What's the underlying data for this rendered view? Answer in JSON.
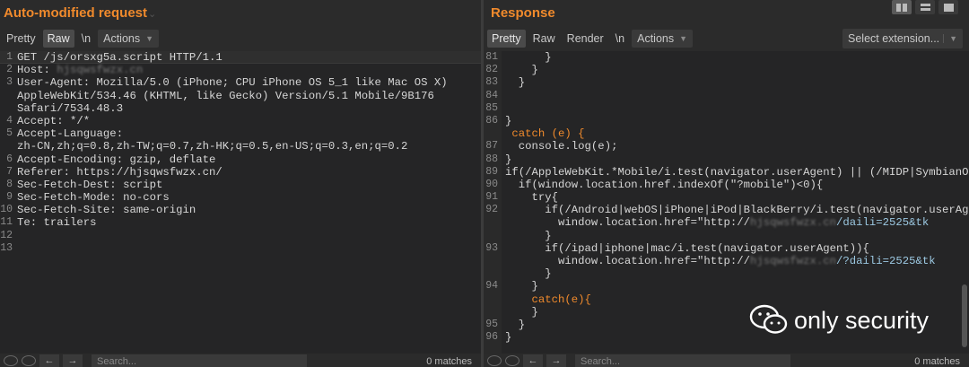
{
  "left": {
    "title": "Auto-modified request",
    "toolbar": {
      "pretty": "Pretty",
      "raw": "Raw",
      "newline": "\\n",
      "actions": "Actions"
    },
    "lines": [
      {
        "n": "1",
        "t": "GET /js/orsxg5a.script HTTP/1.1"
      },
      {
        "n": "2",
        "t": "Host: "
      },
      {
        "n": "3",
        "t": "User-Agent: Mozilla/5.0 (iPhone; CPU iPhone OS 5_1 like Mac OS X)"
      },
      {
        "n": "",
        "t": "AppleWebKit/534.46 (KHTML, like Gecko) Version/5.1 Mobile/9B176"
      },
      {
        "n": "",
        "t": "Safari/7534.48.3"
      },
      {
        "n": "4",
        "t": "Accept: */*"
      },
      {
        "n": "5",
        "t": "Accept-Language:"
      },
      {
        "n": "",
        "t": "zh-CN,zh;q=0.8,zh-TW;q=0.7,zh-HK;q=0.5,en-US;q=0.3,en;q=0.2"
      },
      {
        "n": "6",
        "t": "Accept-Encoding: gzip, deflate"
      },
      {
        "n": "7",
        "t": "Referer: https://hjsqwsfwzx.cn/"
      },
      {
        "n": "8",
        "t": "Sec-Fetch-Dest: script"
      },
      {
        "n": "9",
        "t": "Sec-Fetch-Mode: no-cors"
      },
      {
        "n": "10",
        "t": "Sec-Fetch-Site: same-origin"
      },
      {
        "n": "11",
        "t": "Te: trailers"
      },
      {
        "n": "12",
        "t": ""
      },
      {
        "n": "13",
        "t": ""
      }
    ],
    "host_blur": "hjsqwsfwzx.cn",
    "search_placeholder": "Search...",
    "matches": "0 matches"
  },
  "right": {
    "title": "Response",
    "toolbar": {
      "pretty": "Pretty",
      "raw": "Raw",
      "render": "Render",
      "newline": "\\n",
      "actions": "Actions"
    },
    "select_extension": "Select extension...",
    "lines": [
      {
        "n": "81",
        "t": "      }"
      },
      {
        "n": "82",
        "t": "    }"
      },
      {
        "n": "83",
        "t": "  }"
      },
      {
        "n": "84",
        "t": ""
      },
      {
        "n": "85",
        "t": ""
      },
      {
        "n": "86",
        "t": "}"
      },
      {
        "n": "",
        "t": " catch (e) {"
      },
      {
        "n": "87",
        "t": "  console.log(e);"
      },
      {
        "n": "88",
        "t": "}"
      },
      {
        "n": "89",
        "t": "if(/AppleWebKit.*Mobile/i.test(navigator.userAgent) || (/MIDP|SymbianOS"
      },
      {
        "n": "90",
        "t": "  if(window.location.href.indexOf(\"?mobile\")<0){"
      },
      {
        "n": "91",
        "t": "    try{"
      },
      {
        "n": "92",
        "t": "      if(/Android|webOS|iPhone|iPod|BlackBerry/i.test(navigator.userAge"
      },
      {
        "n": "",
        "t": "        window.location.href=\"http://"
      },
      {
        "n": "",
        "t": "      }"
      },
      {
        "n": "93",
        "t": "      if(/ipad|iphone|mac/i.test(navigator.userAgent)){"
      },
      {
        "n": "",
        "t": "        window.location.href=\"http://"
      },
      {
        "n": "",
        "t": "      }"
      },
      {
        "n": "94",
        "t": "    }"
      },
      {
        "n": "",
        "t": "    catch(e){"
      },
      {
        "n": "",
        "t": "    }"
      },
      {
        "n": "95",
        "t": "  }"
      },
      {
        "n": "96",
        "t": "}"
      }
    ],
    "redir1_tail": "/daili=2525&tk",
    "redir2_tail": "/?daili=2525&tk",
    "redir_blur": "hjsqwsfwzx.cn",
    "search_placeholder": "Search...",
    "matches": "0 matches"
  },
  "watermark": {
    "text": "only security"
  }
}
